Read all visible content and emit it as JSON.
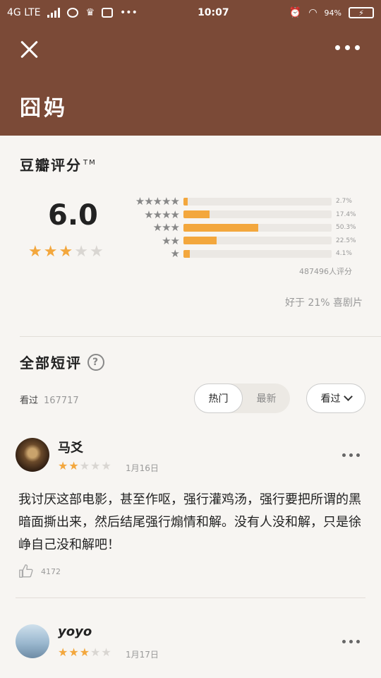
{
  "status_bar": {
    "network": "4G LTE",
    "time": "10:07",
    "battery": "94%"
  },
  "header": {
    "title": "囧妈"
  },
  "rating": {
    "heading": "豆瓣评分",
    "tm": "TM",
    "score": "6.0",
    "stars_filled": 3,
    "stars_total": 5,
    "distribution": [
      {
        "stars": "★★★★★",
        "percent": 2.7,
        "label": "2.7%"
      },
      {
        "stars": "★★★★",
        "percent": 17.4,
        "label": "17.4%"
      },
      {
        "stars": "★★★",
        "percent": 50.3,
        "label": "50.3%"
      },
      {
        "stars": "★★",
        "percent": 22.5,
        "label": "22.5%"
      },
      {
        "stars": "★",
        "percent": 4.1,
        "label": "4.1%"
      }
    ],
    "rating_count": "487496人评分",
    "better_than": "好于 21% 喜剧片"
  },
  "comments": {
    "heading": "全部短评",
    "seen_label": "看过",
    "seen_count": "167717",
    "tabs": [
      "热门",
      "最新"
    ],
    "filter_label": "看过",
    "items": [
      {
        "name": "马爻",
        "stars": 2,
        "date": "1月16日",
        "text": "我讨厌这部电影，甚至作呕，强行灌鸡汤，强行要把所谓的黑暗面撕出来，然后结尾强行煽情和解。没有人没和解，只是徐峥自己没和解吧！",
        "likes": "4172"
      },
      {
        "name": "yoyo",
        "stars": 3,
        "date": "1月17日"
      }
    ]
  },
  "colors": {
    "header_bg": "#7b4a37",
    "star": "#f3a73d"
  }
}
